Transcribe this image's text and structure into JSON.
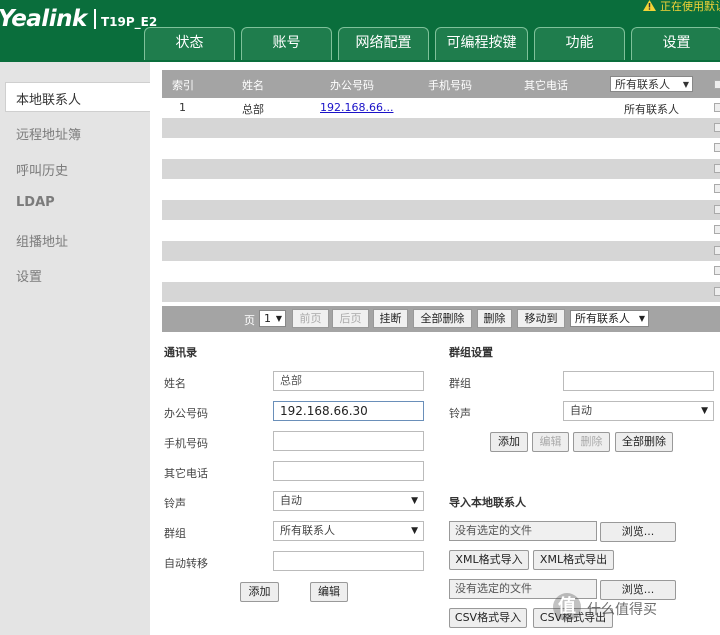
{
  "header": {
    "brand": "Yealink",
    "model": "T19P_E2",
    "status_notice": "正在使用默认",
    "tabs": [
      "状态",
      "账号",
      "网络配置",
      "可编程按键",
      "功能",
      "设置"
    ]
  },
  "sidebar": {
    "items": [
      "本地联系人",
      "远程地址簿",
      "呼叫历史",
      "LDAP",
      "组播地址",
      "设置"
    ],
    "active_index": 0
  },
  "table": {
    "columns": [
      "索引",
      "姓名",
      "办公号码",
      "手机号码",
      "其它电话"
    ],
    "filter": "所有联系人",
    "rows": [
      {
        "index": "1",
        "name": "总部",
        "office": "192.168.66...",
        "mobile": "",
        "other": "",
        "group": "所有联系人"
      }
    ]
  },
  "pager": {
    "page_label": "页",
    "page_value": "1",
    "prev": "前页",
    "next": "后页",
    "hangup": "挂断",
    "delete_all": "全部删除",
    "delete": "删除",
    "move_to": "移动到",
    "move_target": "所有联系人"
  },
  "contact_form": {
    "title": "通讯录",
    "name_label": "姓名",
    "name_value": "总部",
    "office_label": "办公号码",
    "office_value": "192.168.66.30",
    "mobile_label": "手机号码",
    "mobile_value": "",
    "other_label": "其它电话",
    "other_value": "",
    "ring_label": "铃声",
    "ring_value": "自动",
    "group_label": "群组",
    "group_value": "所有联系人",
    "forward_label": "自动转移",
    "forward_value": "",
    "add_button": "添加",
    "edit_button": "编辑"
  },
  "group_settings": {
    "title": "群组设置",
    "group_label": "群组",
    "group_value": "",
    "ring_label": "铃声",
    "ring_value": "自动",
    "add_button": "添加",
    "edit_button": "编辑",
    "delete_button": "删除",
    "delete_all_button": "全部删除"
  },
  "import": {
    "title": "导入本地联系人",
    "no_file": "没有选定的文件",
    "browse": "浏览...",
    "xml_import": "XML格式导入",
    "xml_export": "XML格式导出",
    "csv_import": "CSV格式导入",
    "csv_export": "CSV格式导出"
  },
  "watermark": {
    "badge": "值",
    "text": "什么值得买"
  },
  "colors": {
    "header_green": "#0a6e3c",
    "tab_green": "#1f7d4d",
    "warning_yellow": "#f3d337",
    "table_head_gray": "#a4a4a4",
    "link_blue": "#1a12c8"
  }
}
